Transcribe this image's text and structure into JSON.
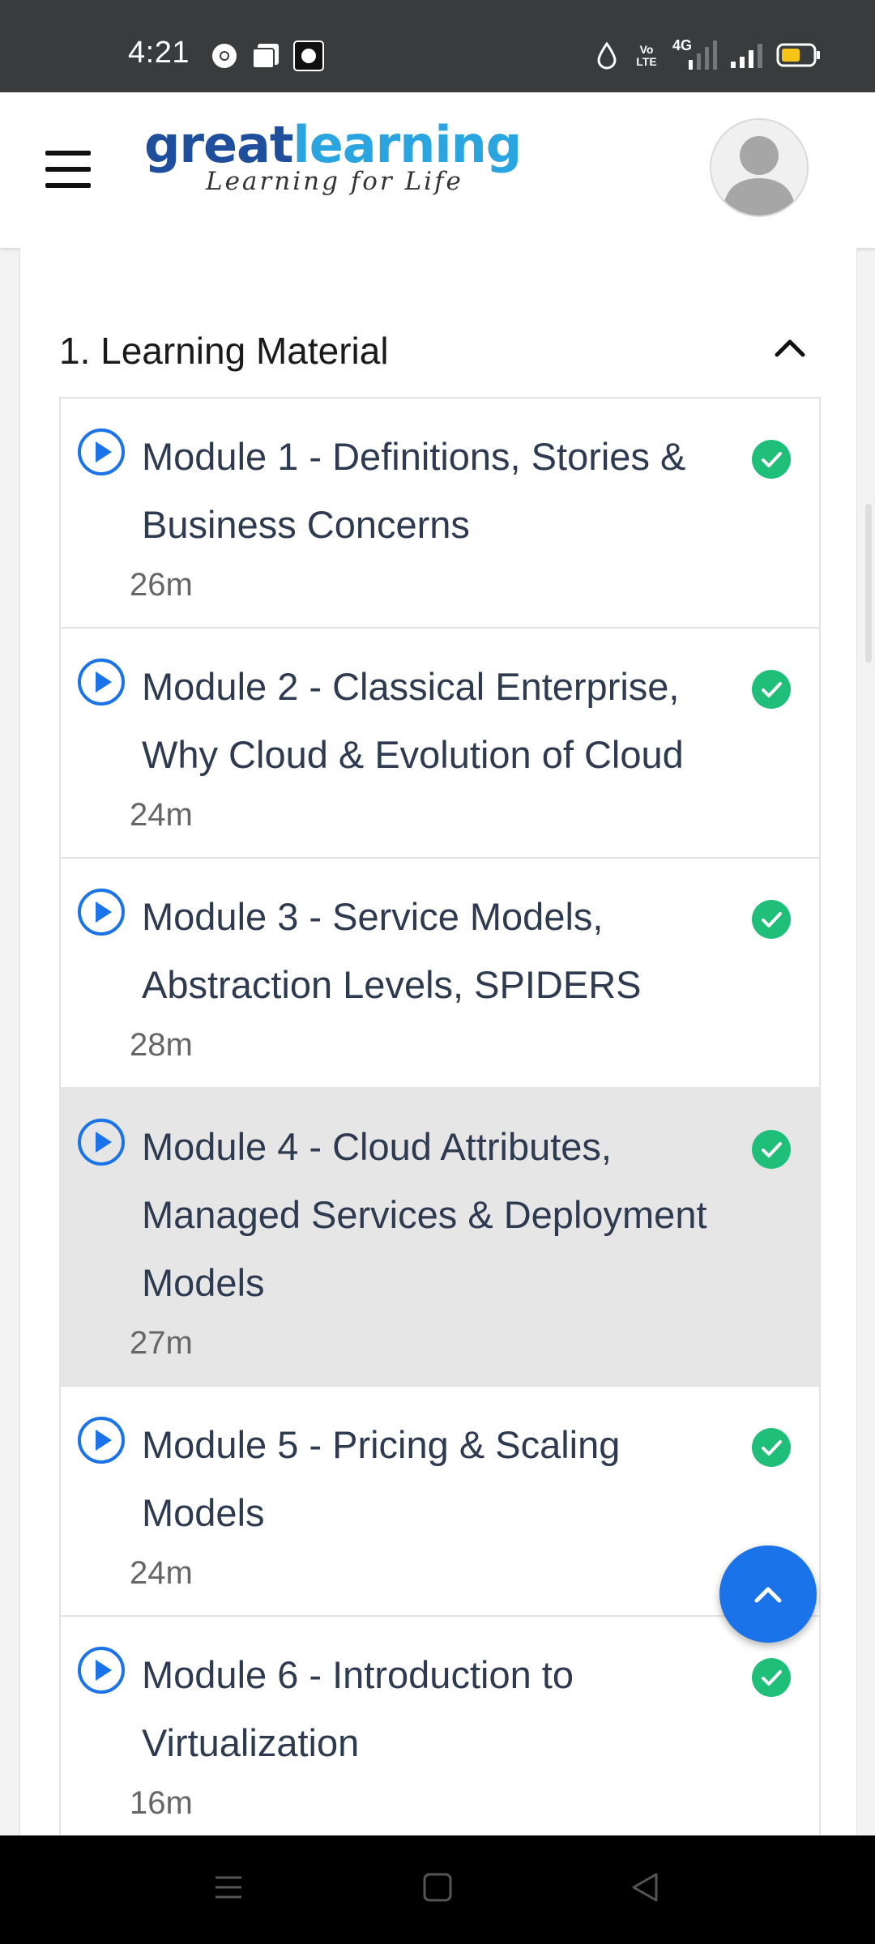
{
  "status_bar": {
    "time": "4:21",
    "left_icons": [
      "chrome-icon",
      "photos-icon",
      "app-icon"
    ],
    "right_icons": [
      "data-saver-icon",
      "volte-icon",
      "4g-signal-icon",
      "signal-icon",
      "battery-icon"
    ],
    "volte_label": "Vo LTE",
    "network_label": "4G"
  },
  "header": {
    "brand_part1": "great",
    "brand_part2": "learning",
    "tagline": "Learning for Life",
    "colors": {
      "brand_dark": "#1f4f9c",
      "brand_light": "#2aa5e0"
    }
  },
  "section": {
    "title": "1. Learning Material",
    "expanded": true
  },
  "modules": [
    {
      "title": "Module 1 - Definitions, Stories & Business Concerns",
      "duration": "26m",
      "completed": true,
      "active": false
    },
    {
      "title": "Module 2 - Classical Enterprise, Why Cloud & Evolution of Cloud",
      "duration": "24m",
      "completed": true,
      "active": false
    },
    {
      "title": "Module 3 - Service Models, Abstraction Levels, SPIDERS",
      "duration": "28m",
      "completed": true,
      "active": false
    },
    {
      "title": "Module 4 - Cloud Attributes, Managed Services & Deployment Models",
      "duration": "27m",
      "completed": true,
      "active": true
    },
    {
      "title": "Module 5 - Pricing & Scaling Models",
      "duration": "24m",
      "completed": true,
      "active": false
    },
    {
      "title": "Module 6 - Introduction to Virtualization",
      "duration": "16m",
      "completed": true,
      "active": false
    }
  ],
  "colors": {
    "play_icon": "#1a73e8",
    "check_icon": "#1fbf7a",
    "fab": "#1a73e8",
    "active_row": "#e6e6e6"
  },
  "fab_icon": "chevron-up-icon",
  "nav_bar": [
    "recents-icon",
    "home-icon",
    "back-icon"
  ]
}
